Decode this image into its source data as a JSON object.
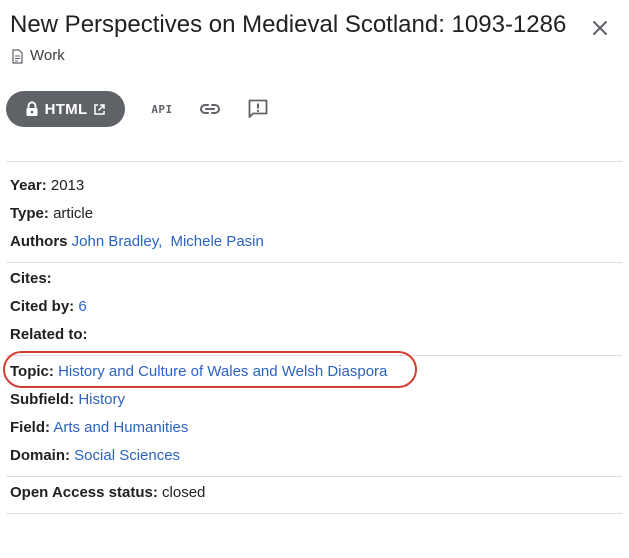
{
  "header": {
    "title": "New Perspectives on Medieval Scotland: 1093-1286",
    "subtype_label": "Work"
  },
  "toolbar": {
    "html_label": "HTML",
    "api_label": "API"
  },
  "details": {
    "year_label": "Year:",
    "year_value": "2013",
    "type_label": "Type:",
    "type_value": "article",
    "authors_label": "Authors",
    "authors": [
      "John Bradley,",
      "Michele Pasin"
    ],
    "cites_label": "Cites:",
    "cited_by_label": "Cited by:",
    "cited_by_value": "6",
    "related_label": "Related to:",
    "topic_label": "Topic:",
    "topic_value": "History and Culture of Wales and Welsh Diaspora",
    "subfield_label": "Subfield:",
    "subfield_value": "History",
    "field_label": "Field:",
    "field_value": "Arts and Humanities",
    "domain_label": "Domain:",
    "domain_value": "Social Sciences",
    "oa_label": "Open Access status:",
    "oa_value": "closed"
  },
  "colors": {
    "link": "#2b63c0",
    "highlight_ring": "#d23f31",
    "button_bg": "#5f6368"
  }
}
